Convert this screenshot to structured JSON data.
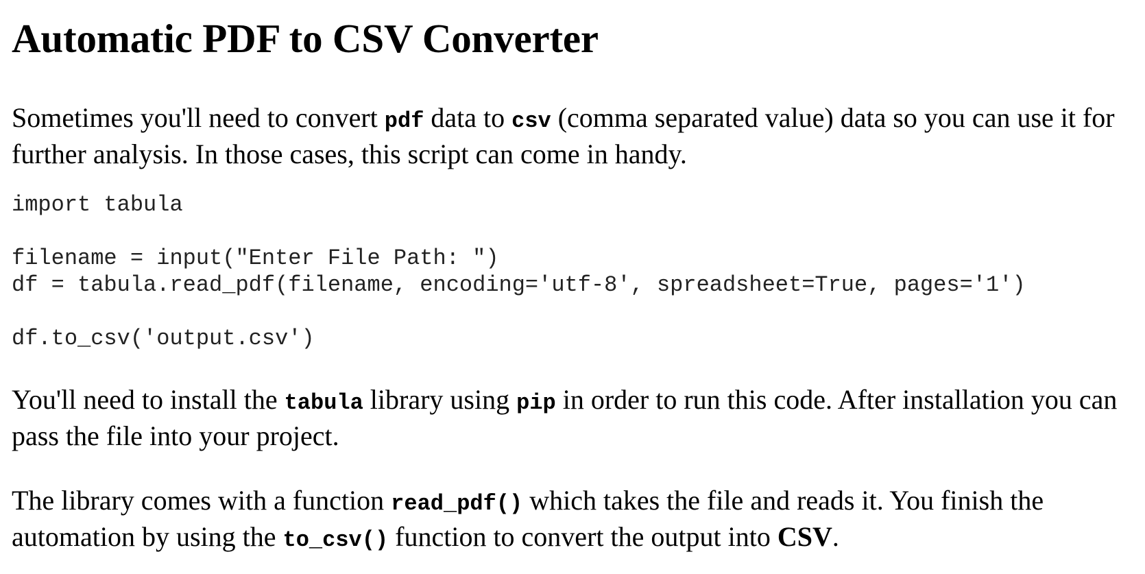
{
  "title": "Automatic PDF to CSV Converter",
  "intro": {
    "t1": "Sometimes you'll need to convert ",
    "code1": "pdf",
    "t2": " data to ",
    "code2": "csv",
    "t3": " (comma separated value) data so you can use it for further analysis. In those cases, this script can come in handy."
  },
  "code_lines": [
    "import tabula",
    "",
    "filename = input(\"Enter File Path: \")",
    "df = tabula.read_pdf(filename, encoding='utf-8', spreadsheet=True, pages='1')",
    "",
    "df.to_csv('output.csv')"
  ],
  "install": {
    "t1": "You'll need to install the ",
    "code1": "tabula",
    "t2": " library using ",
    "code2": "pip",
    "t3": " in order to run this code. After installation you can pass the file into your project."
  },
  "library": {
    "t1": "The library comes with a function ",
    "code1": "read_pdf()",
    "t2": " which takes the file and reads it. You finish the automation by using the ",
    "code2": "to_csv()",
    "t3": " function to convert the output into ",
    "bold": "CSV",
    "t4": "."
  }
}
